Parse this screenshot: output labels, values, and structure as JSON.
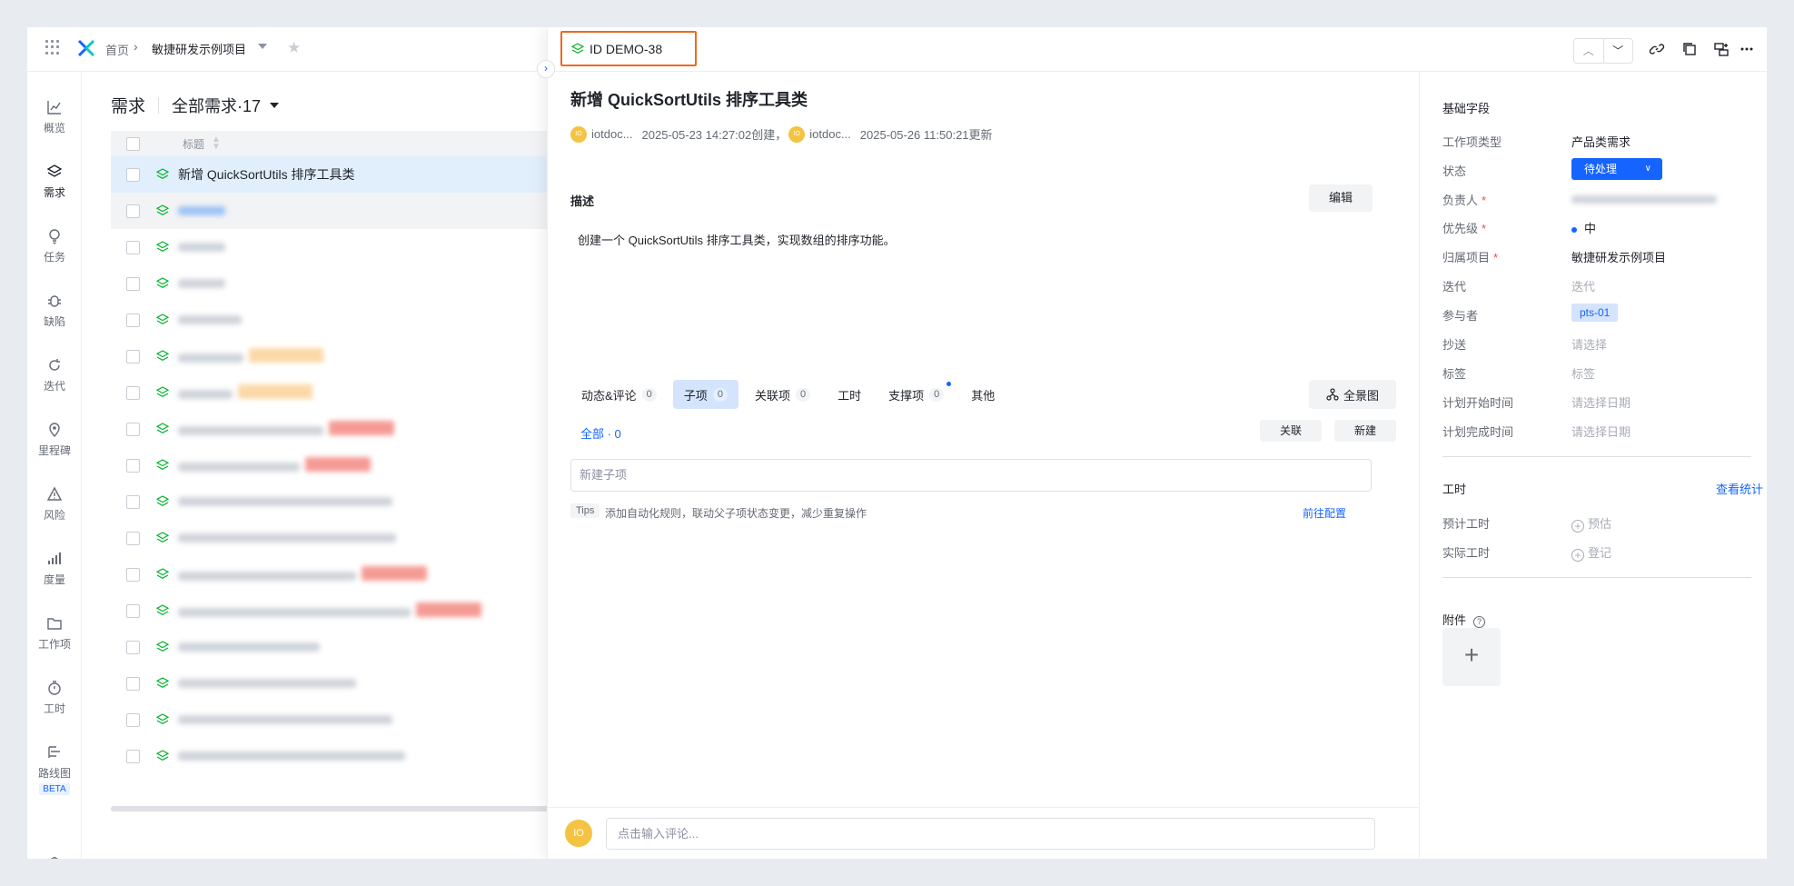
{
  "breadcrumb": {
    "home": "首页",
    "project": "敏捷研发示例项目"
  },
  "rail": [
    {
      "label": "概览",
      "icon": "chart-line-icon"
    },
    {
      "label": "需求",
      "icon": "layers-icon"
    },
    {
      "label": "任务",
      "icon": "bulb-icon"
    },
    {
      "label": "缺陷",
      "icon": "bug-icon"
    },
    {
      "label": "迭代",
      "icon": "cycle-icon"
    },
    {
      "label": "里程碑",
      "icon": "pin-icon"
    },
    {
      "label": "风险",
      "icon": "warning-icon"
    },
    {
      "label": "度量",
      "icon": "bar-chart-icon"
    },
    {
      "label": "工作项",
      "icon": "folder-icon"
    },
    {
      "label": "工时",
      "icon": "timer-icon"
    },
    {
      "label": "路线图",
      "icon": "roadmap-icon",
      "badge": "BETA"
    }
  ],
  "list": {
    "title": "需求",
    "filter": "全部需求·17",
    "column_title": "标题",
    "selected_row": "新增 QuickSortUtils 排序工具类"
  },
  "detail": {
    "id": "ID DEMO-38",
    "title": "新增 QuickSortUtils 排序工具类",
    "creator": "iotdoc...",
    "created": "2025-05-23 14:27:02创建，",
    "updater": "iotdoc...",
    "updated": "2025-05-26 11:50:21更新",
    "avatar_text": "IO",
    "desc_label": "描述",
    "edit": "编辑",
    "description": "创建一个 QuickSortUtils 排序工具类，实现数组的排序功能。",
    "tabs": [
      {
        "label": "动态&评论",
        "count": "0"
      },
      {
        "label": "子项",
        "count": "0"
      },
      {
        "label": "关联项",
        "count": "0"
      },
      {
        "label": "工时"
      },
      {
        "label": "支撑项",
        "count": "0"
      },
      {
        "label": "其他"
      }
    ],
    "panorama": "全景图",
    "sub_all": "全部 · 0",
    "link_btn": "关联",
    "new_btn": "新建",
    "new_sub_placeholder": "新建子项",
    "tips_tag": "Tips",
    "tips_text": "添加自动化规则，联动父子项状态变更，减少重复操作",
    "tips_link": "前往配置",
    "comment_placeholder": "点击输入评论..."
  },
  "side": {
    "basic_title": "基础字段",
    "fields": {
      "type_label": "工作项类型",
      "type_value": "产品类需求",
      "status_label": "状态",
      "status_value": "待处理",
      "owner_label": "负责人",
      "priority_label": "优先级",
      "priority_value": "中",
      "project_label": "归属项目",
      "project_value": "敏捷研发示例项目",
      "iteration_label": "迭代",
      "iteration_value": "迭代",
      "participants_label": "参与者",
      "participants_value": "pts-01",
      "cc_label": "抄送",
      "cc_value": "请选择",
      "tags_label": "标签",
      "tags_value": "标签",
      "plan_start_label": "计划开始时间",
      "plan_start_value": "请选择日期",
      "plan_end_label": "计划完成时间",
      "plan_end_value": "请选择日期"
    },
    "hours_title": "工时",
    "stats_link": "查看统计",
    "est_label": "预计工时",
    "est_value": "预估",
    "actual_label": "实际工时",
    "actual_value": "登记",
    "attach_title": "附件",
    "required_mark": "*"
  },
  "colors": {
    "accent": "#1664ff",
    "highlight": "#ee6a1f",
    "selected_row": "#e1effd"
  }
}
